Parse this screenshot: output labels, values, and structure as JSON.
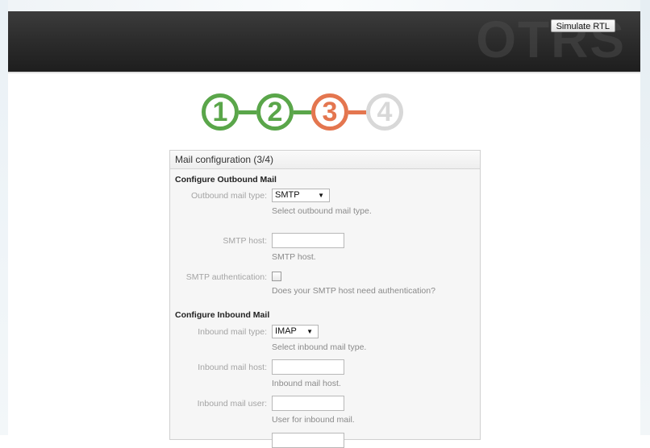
{
  "header": {
    "logo": "OTRS",
    "simulate_rtl_label": "Simulate RTL"
  },
  "steps": [
    "1",
    "2",
    "3",
    "4"
  ],
  "panel": {
    "title": "Mail configuration (3/4)",
    "outbound": {
      "section_title": "Configure Outbound Mail",
      "type_label": "Outbound mail type:",
      "type_value": "SMTP",
      "type_hint": "Select outbound mail type.",
      "host_label": "SMTP host:",
      "host_value": "",
      "host_hint": "SMTP host.",
      "auth_label": "SMTP authentication:",
      "auth_hint": "Does your SMTP host need authentication?"
    },
    "inbound": {
      "section_title": "Configure Inbound Mail",
      "type_label": "Inbound mail type:",
      "type_value": "IMAP",
      "type_hint": "Select inbound mail type.",
      "host_label": "Inbound mail host:",
      "host_value": "",
      "host_hint": "Inbound mail host.",
      "user_label": "Inbound mail user:",
      "user_value": "",
      "user_hint": "User for inbound mail."
    }
  },
  "colors": {
    "step_done": "#5aa64a",
    "step_active": "#e4764f",
    "step_todo": "#d8d8d8"
  }
}
